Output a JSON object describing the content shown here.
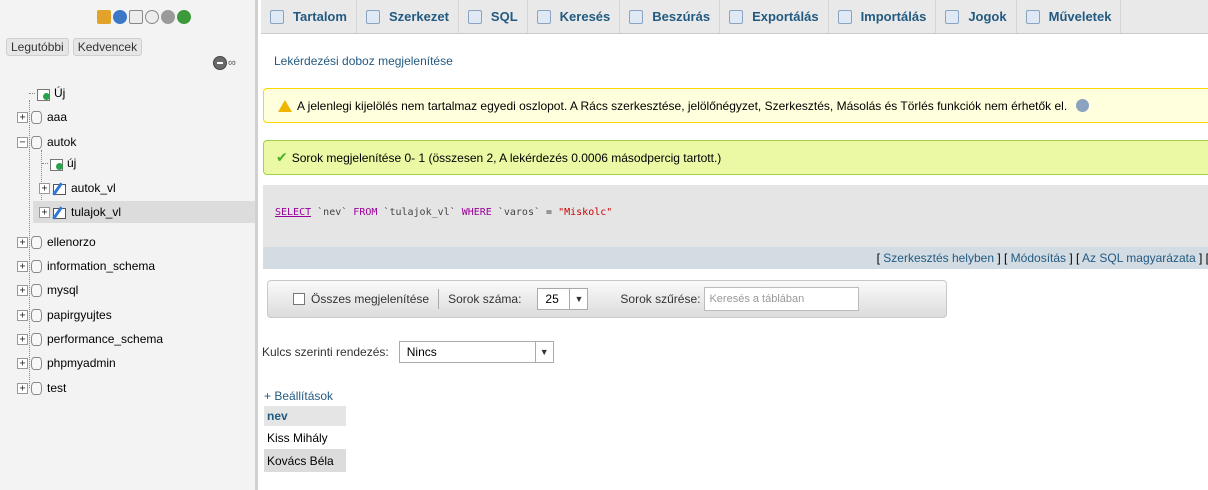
{
  "nav": {
    "tabs": [
      "Legutóbbi",
      "Kedvencek"
    ],
    "tree": {
      "new_label": "Új",
      "databases": [
        "aaa",
        "autok",
        "ellenorzo",
        "information_schema",
        "mysql",
        "papirgyujtes",
        "performance_schema",
        "phpmyadmin",
        "test"
      ],
      "autok_children": [
        "új",
        "autok_vl",
        "tulajok_vl"
      ]
    }
  },
  "topbar": {
    "tabs": [
      "Tartalom",
      "Szerkezet",
      "SQL",
      "Keresés",
      "Beszúrás",
      "Exportálás",
      "Importálás",
      "Jogok",
      "Műveletek"
    ]
  },
  "main": {
    "query_box_link": "Lekérdezési doboz megjelenítése",
    "notice": "A jelenlegi kijelölés nem tartalmaz egyedi oszlopot. A Rács szerkesztése, jelölőnégyzet, Szerkesztés, Másolás és Törlés funkciók nem érhetők el.",
    "success": "Sorok megjelenítése 0- 1 (összesen 2, A lekérdezés 0.0006 másodpercig tartott.)",
    "sql": {
      "select": "SELECT",
      "col": "`nev`",
      "from": "FROM",
      "table": "`tulajok_vl`",
      "where": "WHERE",
      "field": "`varos`",
      "op": "=",
      "value": "\"Miskolc\""
    },
    "sql_actions": {
      "inline_edit": "Szerkesztés helyben",
      "modify": "Módosítás",
      "explain": "Az SQL magyarázata"
    },
    "navbar": {
      "show_all": "Összes megjelenítése",
      "row_count_label": "Sorok száma:",
      "row_count_value": "25",
      "filter_label": "Sorok szűrése:",
      "filter_placeholder": "Keresés a táblában"
    },
    "sort": {
      "label": "Kulcs szerinti rendezés:",
      "value": "Nincs"
    },
    "settings_link": "+ Beállítások",
    "table": {
      "header": "nev",
      "rows": [
        "Kiss Mihály",
        "Kovács Béla"
      ]
    }
  },
  "colors": {
    "link": "#235a81",
    "notice_bg": "#ffffdd",
    "success_bg": "#ebf8a4",
    "sql_keyword": "#990099",
    "sql_string": "#cc0000"
  }
}
